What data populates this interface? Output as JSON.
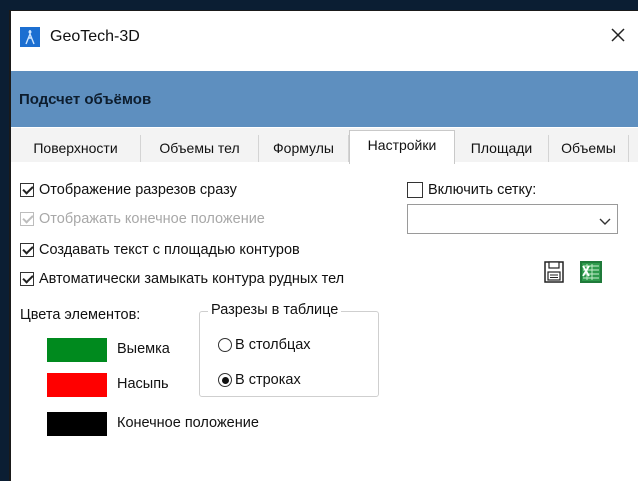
{
  "window": {
    "title": "GeoTech-3D",
    "close_glyph": "✕"
  },
  "header": {
    "title": "Подсчет объёмов"
  },
  "tabs": [
    {
      "label": "Поверхности",
      "active": false
    },
    {
      "label": "Объемы тел",
      "active": false
    },
    {
      "label": "Формулы",
      "active": false
    },
    {
      "label": "Настройки",
      "active": true
    },
    {
      "label": "Площади",
      "active": false
    },
    {
      "label": "Объемы",
      "active": false
    }
  ],
  "settings": {
    "show_sections": {
      "label": "Отображение разрезов сразу",
      "checked": true
    },
    "show_final": {
      "label": "Отображать конечное положение",
      "checked": true,
      "disabled": true
    },
    "create_text": {
      "label": "Создавать текст с площадью контуров",
      "checked": true
    },
    "auto_close": {
      "label": "Автоматически замыкать контура рудных тел",
      "checked": true
    },
    "enable_grid": {
      "label": "Включить сетку:",
      "checked": false
    },
    "grid_select": {
      "value": ""
    }
  },
  "colors": {
    "title": "Цвета элементов:",
    "items": [
      {
        "label": "Выемка",
        "color": "#008a1e"
      },
      {
        "label": "Насыпь",
        "color": "#ff0000"
      },
      {
        "label": "Конечное положение",
        "color": "#000000"
      }
    ]
  },
  "sections_table": {
    "title": "Разрезы в таблице",
    "options": [
      {
        "label": "В столбцах",
        "selected": false
      },
      {
        "label": "В строках",
        "selected": true
      }
    ]
  },
  "icons": {
    "save": "save-icon",
    "excel": "excel-export-icon"
  },
  "accent": {
    "header_bg": "#5e8fbf",
    "app_icon": "#1c6fd1"
  }
}
